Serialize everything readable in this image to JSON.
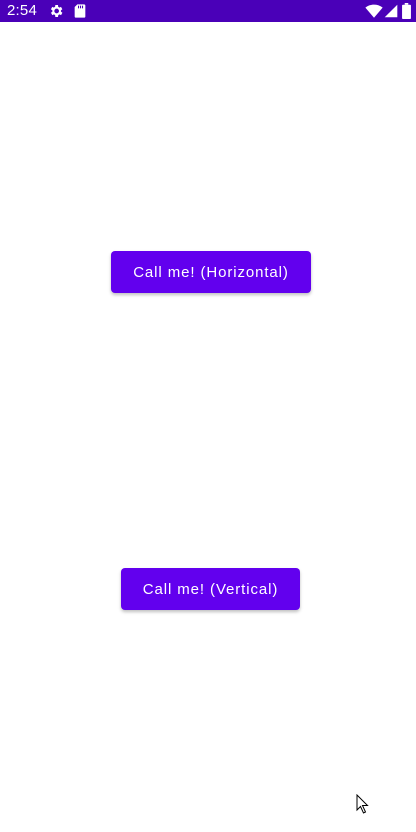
{
  "status_bar": {
    "time": "2:54",
    "background": "#4a00b8",
    "icons": [
      "gear-icon",
      "sd-card-icon",
      "wifi-icon",
      "cell-signal-icon",
      "battery-icon"
    ]
  },
  "main": {
    "horizontal_button_label": "Call me! (Horizontal)",
    "vertical_button_label": "Call me! (Vertical)",
    "button_color": "#6200ee"
  }
}
